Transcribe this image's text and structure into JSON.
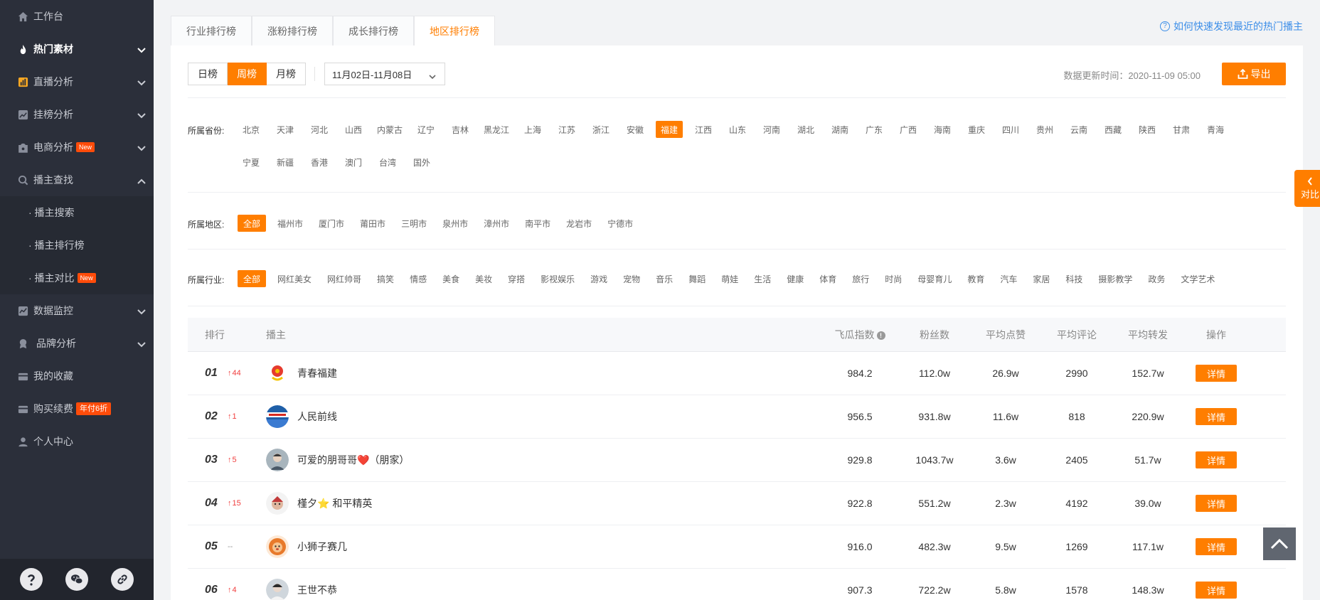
{
  "sidebar": {
    "items": [
      {
        "label": "工作台",
        "icon": "home-icon"
      },
      {
        "label": "热门素材",
        "icon": "flame-icon",
        "active": true
      },
      {
        "label": "直播分析",
        "icon": "bar-chart-icon"
      },
      {
        "label": "挂榜分析",
        "icon": "trend-icon"
      },
      {
        "label": "电商分析",
        "icon": "shop-icon",
        "badge": "New"
      },
      {
        "label": "播主查找",
        "icon": "search-icon"
      },
      {
        "label": "数据监控",
        "icon": "monitor-icon"
      },
      {
        "label": "品牌分析",
        "icon": "brand-icon"
      },
      {
        "label": "我的收藏",
        "icon": "collection-icon"
      },
      {
        "label": "购买续费",
        "icon": "card-icon",
        "badge": "年付6折"
      },
      {
        "label": "个人中心",
        "icon": "user-icon"
      }
    ],
    "sub_items": [
      {
        "label": "· 播主搜索"
      },
      {
        "label": "· 播主排行榜"
      },
      {
        "label": "· 播主对比",
        "badge": "New"
      }
    ]
  },
  "tabs": [
    "行业排行榜",
    "涨粉排行榜",
    "成长排行榜",
    "地区排行榜"
  ],
  "help_link": "如何快速发现最近的热门播主",
  "period_buttons": [
    "日榜",
    "周榜",
    "月榜"
  ],
  "date_range": "11月02日-11月08日",
  "update_time": "数据更新时间：2020-11-09 05:00",
  "export_label": "导出",
  "filters": {
    "province_label": "所属省份:",
    "provinces": [
      "北京",
      "天津",
      "河北",
      "山西",
      "内蒙古",
      "辽宁",
      "吉林",
      "黑龙江",
      "上海",
      "江苏",
      "浙江",
      "安徽",
      "福建",
      "江西",
      "山东",
      "河南",
      "湖北",
      "湖南",
      "广东",
      "广西",
      "海南",
      "重庆",
      "四川",
      "贵州",
      "云南",
      "西藏",
      "陕西",
      "甘肃",
      "青海",
      "宁夏",
      "新疆",
      "香港",
      "澳门",
      "台湾",
      "国外"
    ],
    "area_label": "所属地区:",
    "areas": [
      "全部",
      "福州市",
      "厦门市",
      "莆田市",
      "三明市",
      "泉州市",
      "漳州市",
      "南平市",
      "龙岩市",
      "宁德市"
    ],
    "industry_label": "所属行业:",
    "industries": [
      "全部",
      "网红美女",
      "网红帅哥",
      "搞笑",
      "情感",
      "美食",
      "美妆",
      "穿搭",
      "影视娱乐",
      "游戏",
      "宠物",
      "音乐",
      "舞蹈",
      "萌娃",
      "生活",
      "健康",
      "体育",
      "旅行",
      "时尚",
      "母婴育儿",
      "教育",
      "汽车",
      "家居",
      "科技",
      "摄影教学",
      "政务",
      "文学艺术"
    ]
  },
  "table": {
    "headers": {
      "rank": "排行",
      "anchor": "播主",
      "index": "飞瓜指数",
      "fans": "粉丝数",
      "likes": "平均点赞",
      "comments": "平均评论",
      "shares": "平均转发",
      "op": "操作"
    },
    "rows": [
      {
        "rank": "01",
        "change": "44",
        "name": "青春福建",
        "index": "984.2",
        "fans": "112.0w",
        "likes": "26.9w",
        "comments": "2990",
        "shares": "152.7w",
        "op": "详情"
      },
      {
        "rank": "02",
        "change": "1",
        "name": "人民前线",
        "index": "956.5",
        "fans": "931.8w",
        "likes": "11.6w",
        "comments": "818",
        "shares": "220.9w",
        "op": "详情"
      },
      {
        "rank": "03",
        "change": "5",
        "name": "可爱的朋哥哥❤️（朋家）",
        "index": "929.8",
        "fans": "1043.7w",
        "likes": "3.6w",
        "comments": "2405",
        "shares": "51.7w",
        "op": "详情"
      },
      {
        "rank": "04",
        "change": "15",
        "name": "槿夕⭐ 和平精英",
        "index": "922.8",
        "fans": "551.2w",
        "likes": "2.3w",
        "comments": "4192",
        "shares": "39.0w",
        "op": "详情"
      },
      {
        "rank": "05",
        "change": "--",
        "name": "小狮子赛几",
        "index": "916.0",
        "fans": "482.3w",
        "likes": "9.5w",
        "comments": "1269",
        "shares": "117.1w",
        "op": "详情"
      },
      {
        "rank": "06",
        "change": "4",
        "name": "王世不恭",
        "index": "907.3",
        "fans": "722.2w",
        "likes": "5.8w",
        "comments": "1578",
        "shares": "148.3w",
        "op": "详情"
      }
    ]
  },
  "compare_label": "对比",
  "colors": {
    "accent": "#ff7e00",
    "sidebar": "#2b2f3a",
    "rise": "#f03e3e",
    "link": "#3c8ee8"
  }
}
